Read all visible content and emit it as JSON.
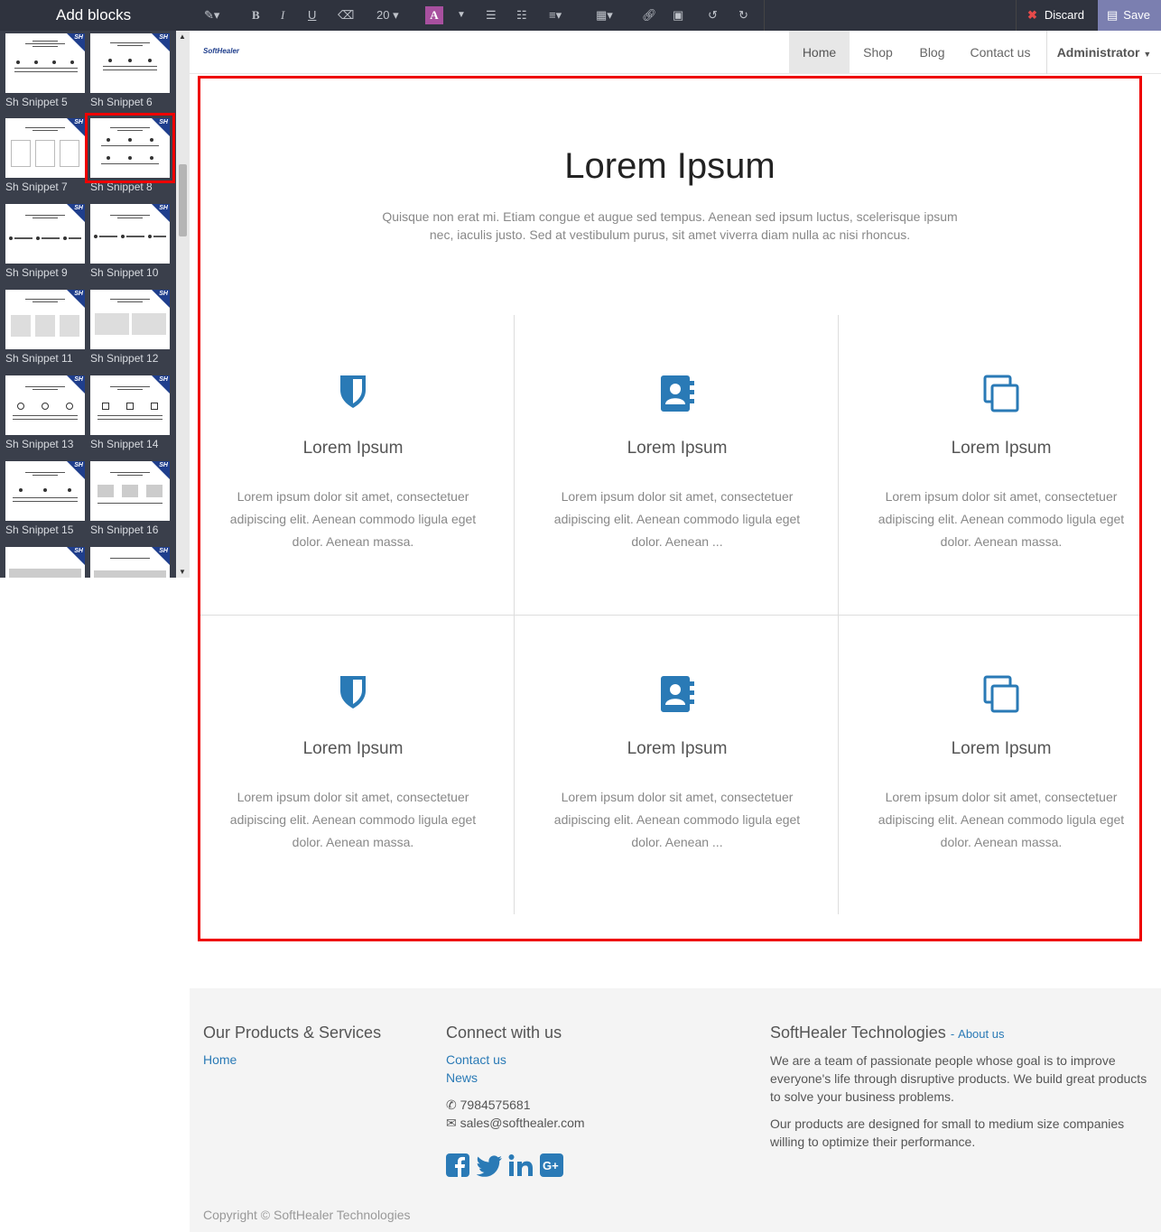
{
  "panel": {
    "title": "Add blocks",
    "snippets": [
      {
        "label": "Sh Snippet 5"
      },
      {
        "label": "Sh Snippet 6"
      },
      {
        "label": "Sh Snippet 7"
      },
      {
        "label": "Sh Snippet 8"
      },
      {
        "label": "Sh Snippet 9"
      },
      {
        "label": "Sh Snippet 10"
      },
      {
        "label": "Sh Snippet 11"
      },
      {
        "label": "Sh Snippet 12"
      },
      {
        "label": "Sh Snippet 13"
      },
      {
        "label": "Sh Snippet 14"
      },
      {
        "label": "Sh Snippet 15"
      },
      {
        "label": "Sh Snippet 16"
      }
    ],
    "thumb_badge": "SH",
    "selected": "Sh Snippet 8"
  },
  "toolbar": {
    "font_size": "20",
    "color_letter": "A",
    "discard_label": "Discard",
    "save_label": "Save"
  },
  "nav": {
    "logo": "SoftHealer",
    "items": [
      "Home",
      "Shop",
      "Blog",
      "Contact us"
    ],
    "active": "Home",
    "user": "Administrator"
  },
  "section": {
    "title": "Lorem Ipsum",
    "subtitle": "Quisque non erat mi. Etiam congue et augue sed tempus. Aenean sed ipsum luctus, scelerisque ipsum nec, iaculis justo. Sed at vestibulum purus, sit amet viverra diam nulla ac nisi rhoncus.",
    "cards": [
      {
        "icon": "shield-icon",
        "title": "Lorem Ipsum",
        "text": "Lorem ipsum dolor sit amet, consectetuer adipiscing elit. Aenean commodo ligula eget dolor. Aenean massa."
      },
      {
        "icon": "address-book-icon",
        "title": "Lorem Ipsum",
        "text": "Lorem ipsum dolor sit amet, consectetuer adipiscing elit. Aenean commodo ligula eget dolor. Aenean ..."
      },
      {
        "icon": "copy-icon",
        "title": "Lorem Ipsum",
        "text": "Lorem ipsum dolor sit amet, consectetuer adipiscing elit. Aenean commodo ligula eget dolor. Aenean massa."
      },
      {
        "icon": "shield-icon",
        "title": "Lorem Ipsum",
        "text": "Lorem ipsum dolor sit amet, consectetuer adipiscing elit. Aenean commodo ligula eget dolor. Aenean massa."
      },
      {
        "icon": "address-book-icon",
        "title": "Lorem Ipsum",
        "text": "Lorem ipsum dolor sit amet, consectetuer adipiscing elit. Aenean commodo ligula eget dolor. Aenean ..."
      },
      {
        "icon": "copy-icon",
        "title": "Lorem Ipsum",
        "text": "Lorem ipsum dolor sit amet, consectetuer adipiscing elit. Aenean commodo ligula eget dolor. Aenean massa."
      }
    ],
    "icon_color": "#2a7ab6"
  },
  "footer": {
    "products_heading": "Our Products & Services",
    "products_links": [
      "Home"
    ],
    "connect_heading": "Connect with us",
    "connect_links": [
      "Contact us",
      "News"
    ],
    "phone": "7984575681",
    "email": "sales@softhealer.com",
    "social_icons": [
      "facebook-icon",
      "twitter-icon",
      "linkedin-icon",
      "google-plus-icon"
    ],
    "company_heading": "SoftHealer Technologies",
    "about_link": "About us",
    "about_p1": "We are a team of passionate people whose goal is to improve everyone's life through disruptive products. We build great products to solve your business problems.",
    "about_p2": "Our products are designed for small to medium size companies willing to optimize their performance.",
    "copyright": "Copyright © SoftHealer Technologies"
  }
}
